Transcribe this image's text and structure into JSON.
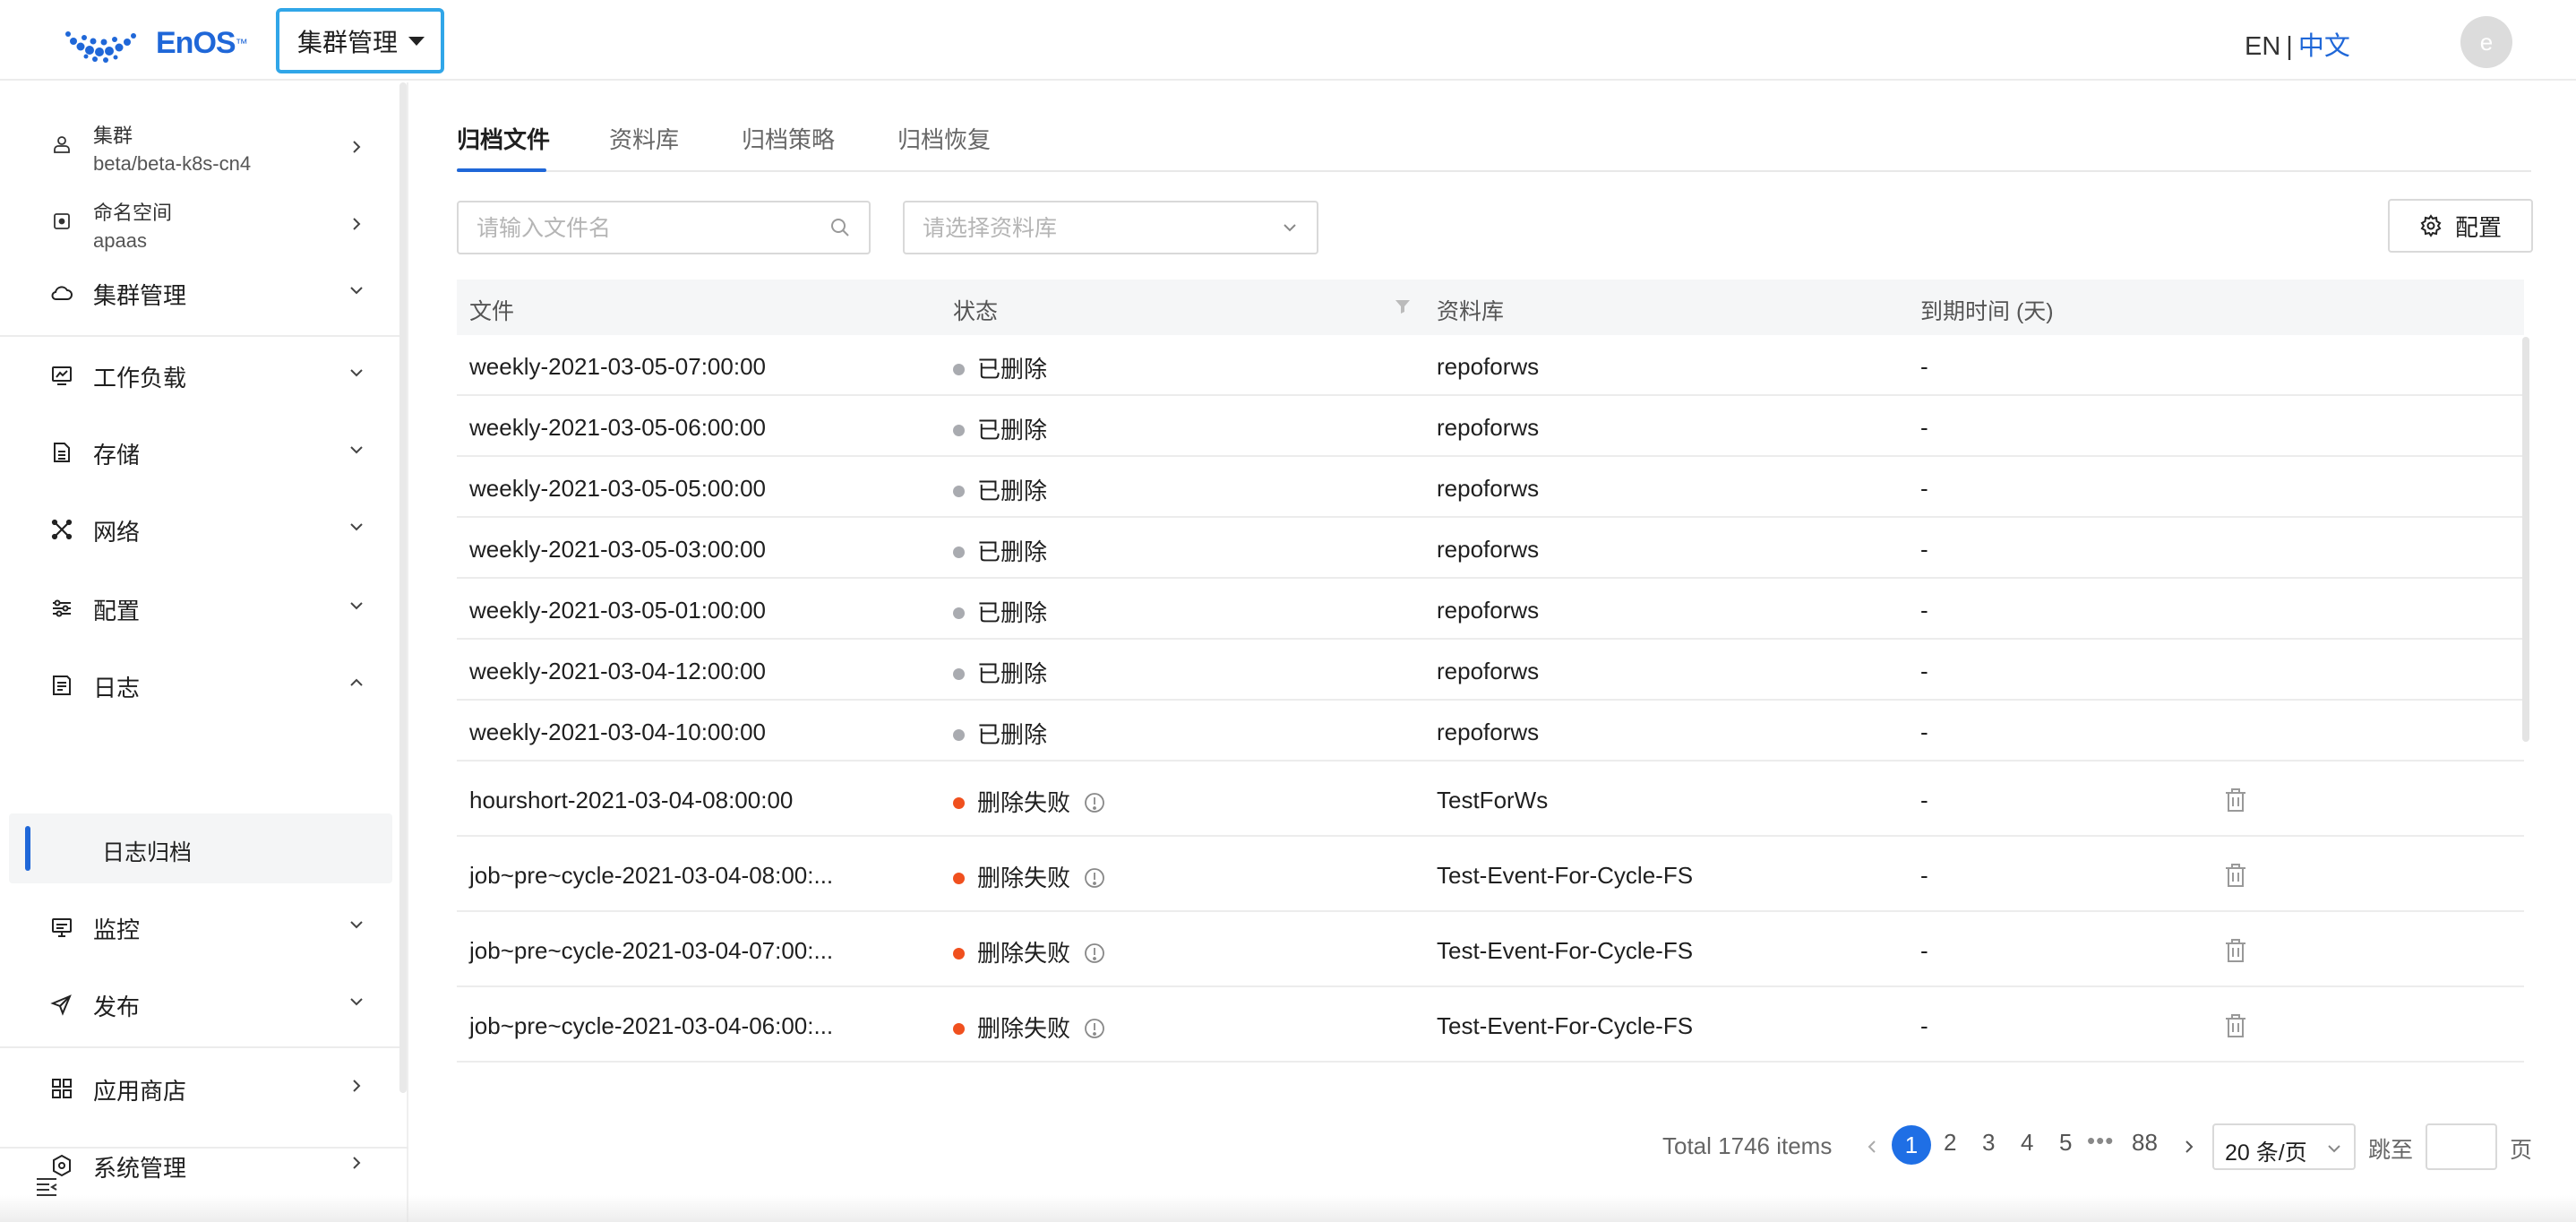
{
  "header": {
    "logo_text": "EnOS",
    "logo_tm": "™",
    "cluster_selector": "集群管理",
    "lang_en": "EN",
    "lang_sep": "|",
    "lang_zh": "中文",
    "avatar_letter": "e"
  },
  "sidebar": {
    "cluster": {
      "label": "集群",
      "value": "beta/beta-k8s-cn4"
    },
    "namespace": {
      "label": "命名空间",
      "value": "apaas"
    },
    "items": [
      {
        "label": "集群管理",
        "icon": "cloud-icon"
      },
      {
        "label": "工作负载",
        "icon": "chart-icon"
      },
      {
        "label": "存储",
        "icon": "storage-icon"
      },
      {
        "label": "网络",
        "icon": "network-icon"
      },
      {
        "label": "配置",
        "icon": "sliders-icon"
      },
      {
        "label": "日志",
        "icon": "log-icon"
      },
      {
        "label": "监控",
        "icon": "monitor-icon"
      },
      {
        "label": "发布",
        "icon": "send-icon"
      },
      {
        "label": "应用商店",
        "icon": "grid-icon"
      },
      {
        "label": "系统管理",
        "icon": "hexagon-icon"
      }
    ],
    "active_sub_item": "日志归档"
  },
  "tabs": [
    "归档文件",
    "资料库",
    "归档策略",
    "归档恢复"
  ],
  "filters": {
    "search_placeholder": "请输入文件名",
    "repo_placeholder": "请选择资料库",
    "config_button": "配置"
  },
  "table": {
    "columns": [
      "文件",
      "状态",
      "资料库",
      "到期时间 (天)"
    ],
    "rows": [
      {
        "file": "weekly-2021-03-05-07:00:00",
        "status": "已删除",
        "status_type": "deleted",
        "repo": "repoforws",
        "expire": "-"
      },
      {
        "file": "weekly-2021-03-05-06:00:00",
        "status": "已删除",
        "status_type": "deleted",
        "repo": "repoforws",
        "expire": "-"
      },
      {
        "file": "weekly-2021-03-05-05:00:00",
        "status": "已删除",
        "status_type": "deleted",
        "repo": "repoforws",
        "expire": "-"
      },
      {
        "file": "weekly-2021-03-05-03:00:00",
        "status": "已删除",
        "status_type": "deleted",
        "repo": "repoforws",
        "expire": "-"
      },
      {
        "file": "weekly-2021-03-05-01:00:00",
        "status": "已删除",
        "status_type": "deleted",
        "repo": "repoforws",
        "expire": "-"
      },
      {
        "file": "weekly-2021-03-04-12:00:00",
        "status": "已删除",
        "status_type": "deleted",
        "repo": "repoforws",
        "expire": "-"
      },
      {
        "file": "weekly-2021-03-04-10:00:00",
        "status": "已删除",
        "status_type": "deleted",
        "repo": "repoforws",
        "expire": "-"
      },
      {
        "file": "hourshort-2021-03-04-08:00:00",
        "status": "删除失败",
        "status_type": "failed",
        "repo": "TestForWs",
        "expire": "-"
      },
      {
        "file": "job~pre~cycle-2021-03-04-08:00:...",
        "status": "删除失败",
        "status_type": "failed",
        "repo": "Test-Event-For-Cycle-FS",
        "expire": "-"
      },
      {
        "file": "job~pre~cycle-2021-03-04-07:00:...",
        "status": "删除失败",
        "status_type": "failed",
        "repo": "Test-Event-For-Cycle-FS",
        "expire": "-"
      },
      {
        "file": "job~pre~cycle-2021-03-04-06:00:...",
        "status": "删除失败",
        "status_type": "failed",
        "repo": "Test-Event-For-Cycle-FS",
        "expire": "-"
      }
    ]
  },
  "pagination": {
    "total_text": "Total 1746 items",
    "current_page": "1",
    "pages": [
      "2",
      "3",
      "4",
      "5"
    ],
    "ellipsis": "•••",
    "last_page": "88",
    "page_size": "20 条/页",
    "jump_label": "跳至",
    "page_label": "页"
  },
  "colors": {
    "accent": "#1f67d8",
    "selector_border": "#30a6e8",
    "status_deleted": "#a9abb0",
    "status_failed": "#f0501e"
  }
}
